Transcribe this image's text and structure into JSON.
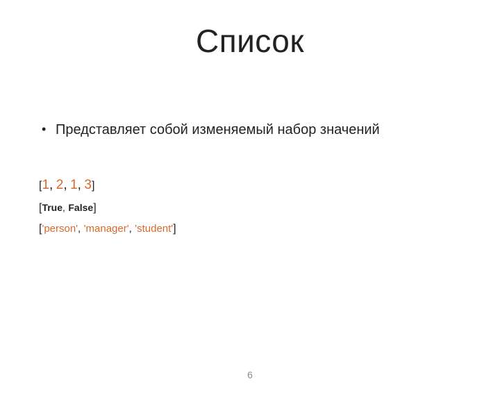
{
  "title": "Список",
  "bullet": "Представляет собой изменяемый набор значений",
  "lines": {
    "l1": {
      "lb": "[",
      "v1": "1",
      "c1": ",",
      "v2": "2",
      "c2": ",",
      "v3": "1",
      "c3": ",",
      "v4": "3",
      "rb": "]"
    },
    "l2": {
      "lb": "[",
      "v1": "True",
      "c1": ",",
      "v2": "False",
      "rb": "]"
    },
    "l3": {
      "lb": "[",
      "v1": "'person'",
      "c1": ",",
      "v2": "'manager'",
      "c2": ",",
      "v3": "'student'",
      "rb": "]"
    }
  },
  "page_number": "6"
}
